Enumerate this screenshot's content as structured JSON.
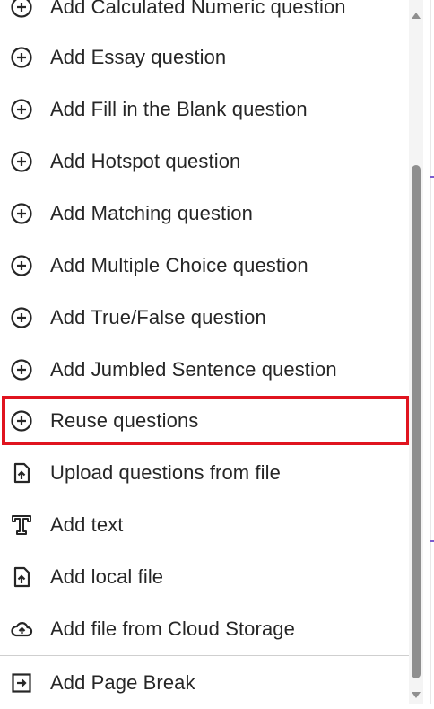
{
  "menu": {
    "items": [
      {
        "label": "Add Calculated Numeric question",
        "icon": "plus-circle-icon"
      },
      {
        "label": "Add Essay question",
        "icon": "plus-circle-icon"
      },
      {
        "label": "Add Fill in the Blank question",
        "icon": "plus-circle-icon"
      },
      {
        "label": "Add Hotspot question",
        "icon": "plus-circle-icon"
      },
      {
        "label": "Add Matching question",
        "icon": "plus-circle-icon"
      },
      {
        "label": "Add Multiple Choice question",
        "icon": "plus-circle-icon"
      },
      {
        "label": "Add True/False question",
        "icon": "plus-circle-icon"
      },
      {
        "label": "Add Jumbled Sentence question",
        "icon": "plus-circle-icon"
      },
      {
        "label": "Reuse questions",
        "icon": "plus-circle-icon"
      },
      {
        "label": "Upload questions from file",
        "icon": "file-upload-icon"
      },
      {
        "label": "Add text",
        "icon": "text-icon"
      },
      {
        "label": "Add local file",
        "icon": "file-upload-icon"
      },
      {
        "label": "Add file from Cloud Storage",
        "icon": "cloud-upload-icon"
      },
      {
        "label": "Add Page Break",
        "icon": "page-break-icon"
      }
    ],
    "highlighted_item": "Reuse questions"
  },
  "colors": {
    "text": "#262626",
    "icon": "#262626",
    "highlight_border": "#e0141f",
    "scroll_thumb": "#8f8f8f"
  }
}
